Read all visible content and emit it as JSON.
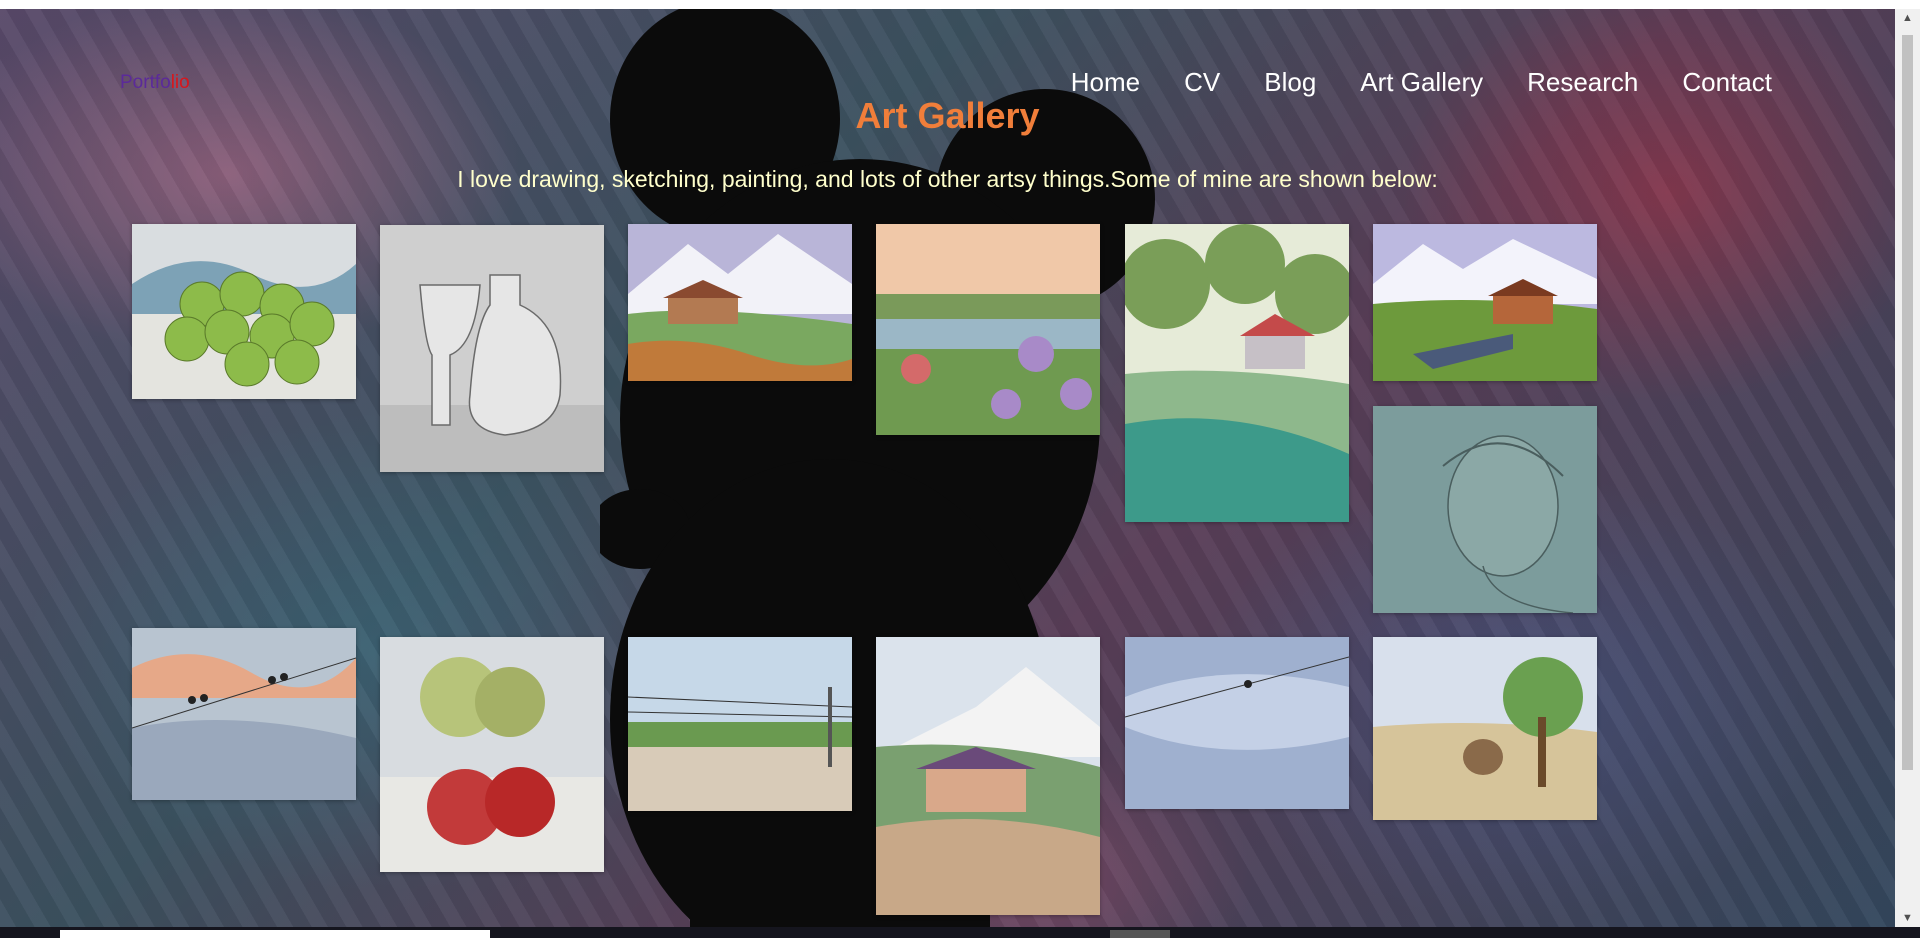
{
  "brand": {
    "part1": "Portfo",
    "part2": "lio"
  },
  "nav": {
    "items": [
      "Home",
      "CV",
      "Blog",
      "Art Gallery",
      "Research",
      "Contact"
    ]
  },
  "page": {
    "title": "Art Gallery",
    "intro": "I love drawing, sketching, painting, and lots of other artsy things.Some of mine are shown below:"
  },
  "gallery": [
    {
      "name": "green-apples-watercolor"
    },
    {
      "name": "vase-glass-pencil-sketch"
    },
    {
      "name": "mountain-village-watercolor"
    },
    {
      "name": "flowers-by-lake-watercolor"
    },
    {
      "name": "house-in-trees-watercolor"
    },
    {
      "name": "himalayan-house-watercolor"
    },
    {
      "name": "portrait-pencil-sketch"
    },
    {
      "name": "birds-on-wire-sunset-watercolor"
    },
    {
      "name": "apples-on-table-watercolor"
    },
    {
      "name": "birds-on-wires-landscape-watercolor"
    },
    {
      "name": "hillside-house-watercolor"
    },
    {
      "name": "bird-on-wire-cloudy-watercolor"
    },
    {
      "name": "tree-and-horse-watercolor"
    }
  ]
}
